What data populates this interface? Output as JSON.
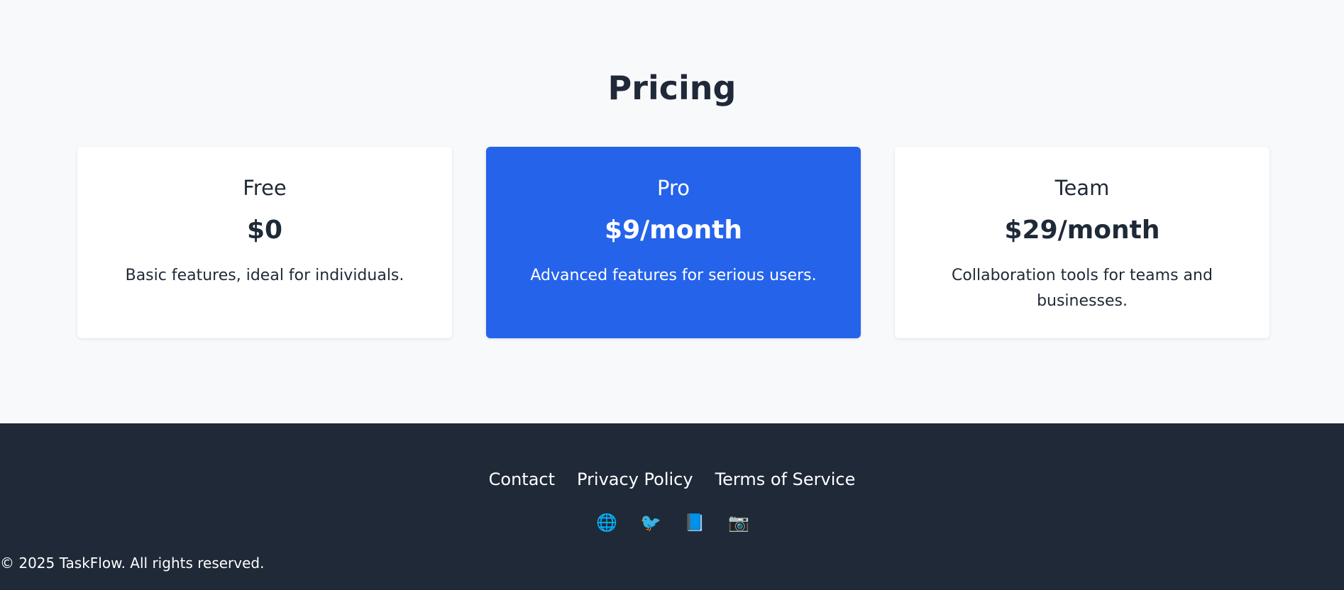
{
  "pricing": {
    "title": "Pricing",
    "plans": [
      {
        "name": "Free",
        "price": "$0",
        "description": "Basic features, ideal for individuals."
      },
      {
        "name": "Pro",
        "price": "$9/month",
        "description": "Advanced features for serious users."
      },
      {
        "name": "Team",
        "price": "$29/month",
        "description": "Collaboration tools for teams and businesses."
      }
    ]
  },
  "footer": {
    "links": [
      "Contact",
      "Privacy Policy",
      "Terms of Service"
    ],
    "social": [
      {
        "icon": "globe-icon",
        "glyph": "🌐"
      },
      {
        "icon": "bird-icon",
        "glyph": "🐦"
      },
      {
        "icon": "book-icon",
        "glyph": "📘"
      },
      {
        "icon": "camera-icon",
        "glyph": "📷"
      }
    ],
    "copyright": "© 2025 TaskFlow. All rights reserved."
  },
  "colors": {
    "accent": "#2563eb",
    "footer_bg": "#1f2937",
    "page_bg": "#f8f9fb"
  }
}
